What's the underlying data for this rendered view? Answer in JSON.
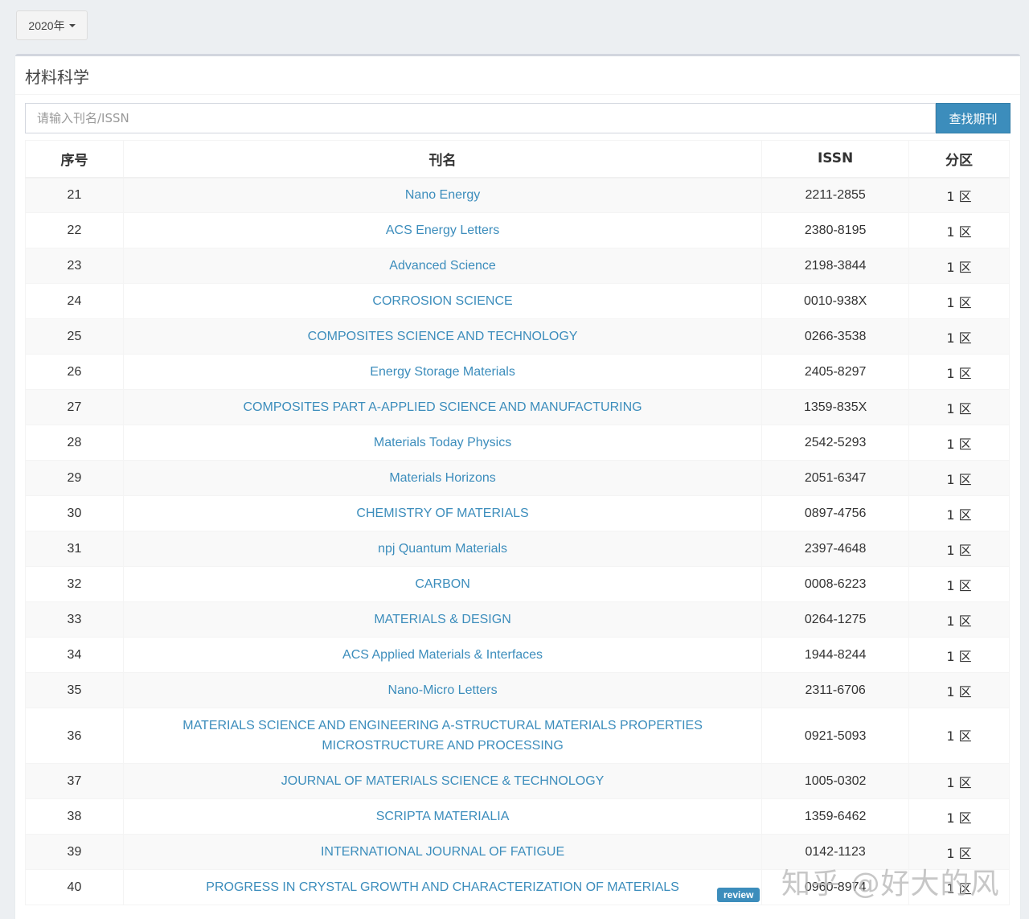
{
  "year_selector": {
    "label": "2020年"
  },
  "box": {
    "title": "材料科学"
  },
  "search": {
    "placeholder": "请输入刊名/ISSN",
    "button_label": "查找期刊"
  },
  "table": {
    "headers": {
      "no": "序号",
      "name": "刊名",
      "issn": "ISSN",
      "quartile": "分区"
    },
    "rows": [
      {
        "no": "21",
        "name": "Nano Energy",
        "issn": "2211-2855",
        "quartile": "1 区"
      },
      {
        "no": "22",
        "name": "ACS Energy Letters",
        "issn": "2380-8195",
        "quartile": "1 区"
      },
      {
        "no": "23",
        "name": "Advanced Science",
        "issn": "2198-3844",
        "quartile": "1 区"
      },
      {
        "no": "24",
        "name": "CORROSION SCIENCE",
        "issn": "0010-938X",
        "quartile": "1 区"
      },
      {
        "no": "25",
        "name": "COMPOSITES SCIENCE AND TECHNOLOGY",
        "issn": "0266-3538",
        "quartile": "1 区"
      },
      {
        "no": "26",
        "name": "Energy Storage Materials",
        "issn": "2405-8297",
        "quartile": "1 区"
      },
      {
        "no": "27",
        "name": "COMPOSITES PART A-APPLIED SCIENCE AND MANUFACTURING",
        "issn": "1359-835X",
        "quartile": "1 区"
      },
      {
        "no": "28",
        "name": "Materials Today Physics",
        "issn": "2542-5293",
        "quartile": "1 区"
      },
      {
        "no": "29",
        "name": "Materials Horizons",
        "issn": "2051-6347",
        "quartile": "1 区"
      },
      {
        "no": "30",
        "name": "CHEMISTRY OF MATERIALS",
        "issn": "0897-4756",
        "quartile": "1 区"
      },
      {
        "no": "31",
        "name": "npj Quantum Materials",
        "issn": "2397-4648",
        "quartile": "1 区"
      },
      {
        "no": "32",
        "name": "CARBON",
        "issn": "0008-6223",
        "quartile": "1 区"
      },
      {
        "no": "33",
        "name": "MATERIALS & DESIGN",
        "issn": "0264-1275",
        "quartile": "1 区"
      },
      {
        "no": "34",
        "name": "ACS Applied Materials & Interfaces",
        "issn": "1944-8244",
        "quartile": "1 区"
      },
      {
        "no": "35",
        "name": "Nano-Micro Letters",
        "issn": "2311-6706",
        "quartile": "1 区"
      },
      {
        "no": "36",
        "name": "MATERIALS SCIENCE AND ENGINEERING A-STRUCTURAL MATERIALS PROPERTIES MICROSTRUCTURE AND PROCESSING",
        "issn": "0921-5093",
        "quartile": "1 区"
      },
      {
        "no": "37",
        "name": "JOURNAL OF MATERIALS SCIENCE & TECHNOLOGY",
        "issn": "1005-0302",
        "quartile": "1 区"
      },
      {
        "no": "38",
        "name": "SCRIPTA MATERIALIA",
        "issn": "1359-6462",
        "quartile": "1 区"
      },
      {
        "no": "39",
        "name": "INTERNATIONAL JOURNAL OF FATIGUE",
        "issn": "0142-1123",
        "quartile": "1 区"
      },
      {
        "no": "40",
        "name": "PROGRESS IN CRYSTAL GROWTH AND CHARACTERIZATION OF MATERIALS",
        "issn": "0960-8974",
        "quartile": "1 区"
      }
    ],
    "review_badge": "review"
  },
  "watermark": "知乎 @好大的风",
  "colors": {
    "link": "#3c8dbc",
    "button": "#3c8dbc",
    "background": "#eceff2"
  }
}
